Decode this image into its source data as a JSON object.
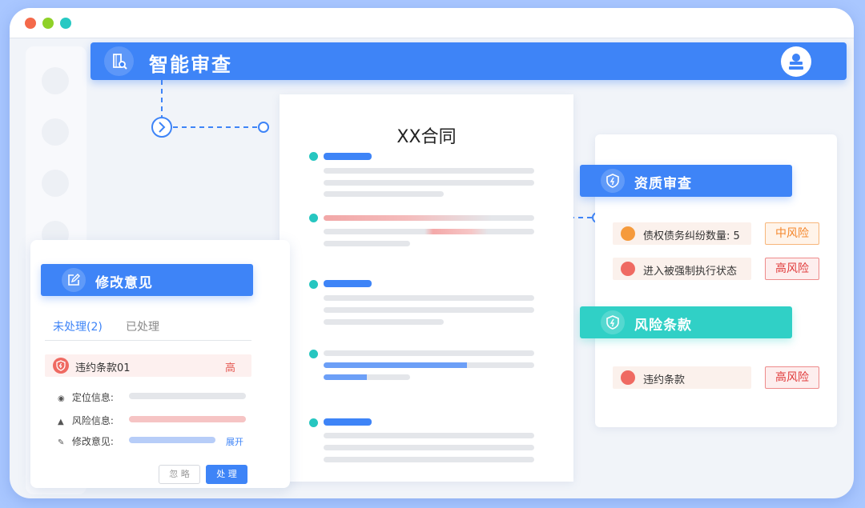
{
  "header": {
    "title": "智能审查"
  },
  "document": {
    "title": "XX合同"
  },
  "edit_panel": {
    "title": "修改意见",
    "tabs": [
      {
        "label": "未处理(2)"
      },
      {
        "label": "已处理"
      }
    ],
    "violation": {
      "label": "违约条款01",
      "level": "高"
    },
    "info": {
      "location_label": "定位信息:",
      "risk_label": "风险信息:",
      "suggestion_label": "修改意见:",
      "expand_label": "展开"
    },
    "buttons": {
      "ignore": "忽 略",
      "process": "处 理"
    }
  },
  "qualification": {
    "title": "资质审查",
    "items": [
      {
        "text": "债权债务纠纷数量: 5",
        "level": "中风险"
      },
      {
        "text": "进入被强制执行状态",
        "level": "高风险"
      }
    ]
  },
  "risk_clauses": {
    "title": "风险条款",
    "items": [
      {
        "text": "违约条款",
        "level": "高风险"
      }
    ]
  },
  "colors": {
    "primary": "#3e84f7",
    "teal": "#30d0c6",
    "high_risk": "#e03a3a",
    "mid_risk": "#f4872c"
  }
}
